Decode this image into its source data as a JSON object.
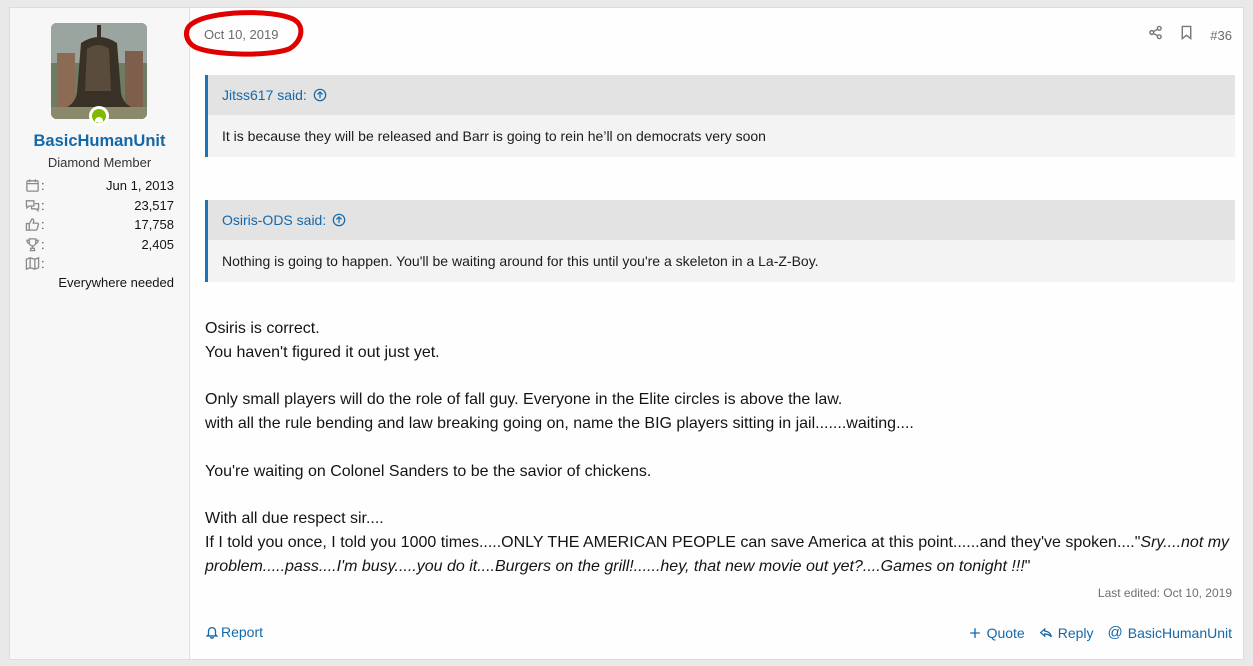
{
  "user": {
    "name": "BasicHumanUnit",
    "title": "Diamond Member",
    "joined": "Jun 1, 2013",
    "messages": "23,517",
    "reactions": "17,758",
    "points": "2,405",
    "location": "Everywhere needed"
  },
  "post": {
    "date": "Oct 10, 2019",
    "number": "#36",
    "quotes": [
      {
        "author": "Jitss617 said:",
        "text": "It is because they will be released and Barr is going to rein he’ll on democrats very soon"
      },
      {
        "author": "Osiris-ODS said:",
        "text": "Nothing is going to happen. You'll be waiting around for this until you're a skeleton in a La-Z-Boy."
      }
    ],
    "body": {
      "l1": "Osiris is correct.",
      "l2": "You haven't figured it out just yet.",
      "l3": "Only small players will do the role of fall guy. Everyone in the Elite circles is above the law.",
      "l4": "with all the rule bending and law breaking going on, name the BIG players sitting in jail.......waiting....",
      "l5": "You're waiting on Colonel Sanders to be the savior of chickens.",
      "l6": "With all due respect sir....",
      "l7_plain": "If I told you once, I told you 1000 times.....ONLY THE AMERICAN PEOPLE can save America at this point......and they've spoken....\"",
      "l7_italic": "Sry....not my problem.....pass....I'm busy.....you do it....Burgers on the grill!......hey, that new movie out yet?....Games on tonight !!!",
      "l7_close": "\""
    },
    "last_edited": "Last edited: Oct 10, 2019"
  },
  "footer": {
    "report": "Report",
    "quote": "Quote",
    "reply": "Reply",
    "mention": "BasicHumanUnit"
  },
  "colors": {
    "link": "#1568a8",
    "quote_bar": "#1c74b8",
    "annotation": "#e00000",
    "online": "#7fb900"
  },
  "icons": [
    "calendar-icon",
    "messages-icon",
    "like-icon",
    "trophy-icon",
    "map-icon",
    "share-icon",
    "bookmark-icon",
    "arrow-up-circle-icon",
    "bell-icon",
    "plus-icon",
    "reply-icon",
    "at-icon"
  ]
}
